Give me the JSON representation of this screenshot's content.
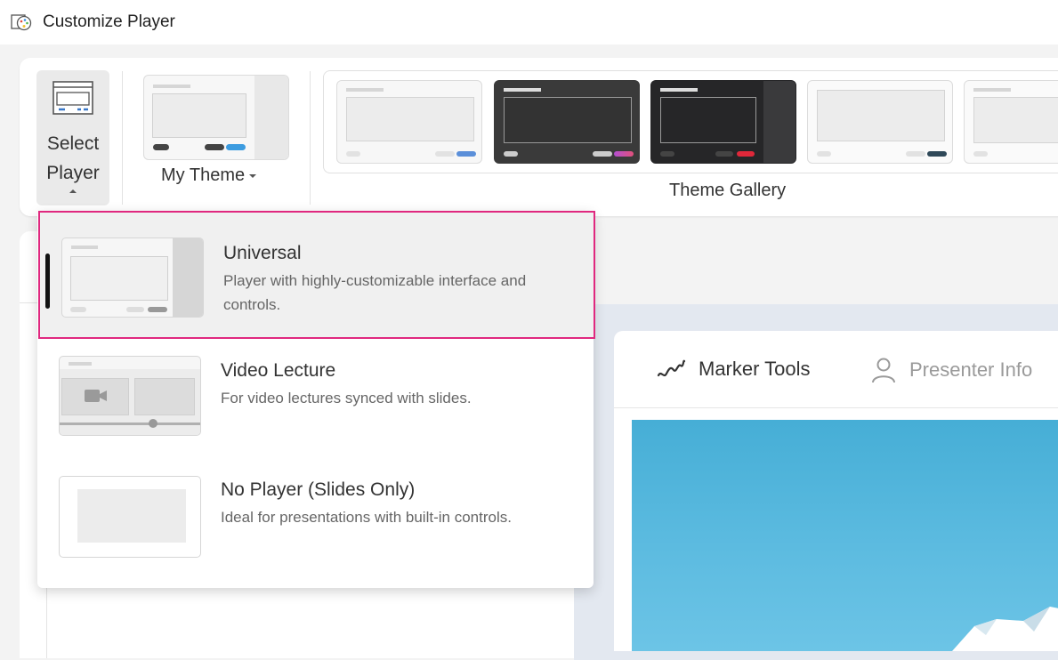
{
  "window": {
    "title": "Customize Player"
  },
  "ribbon": {
    "select_player_label": "Select Player",
    "my_theme_label": "My Theme",
    "theme_gallery_label": "Theme Gallery"
  },
  "player_menu": {
    "options": [
      {
        "title": "Universal",
        "description": "Player with highly-customizable interface and controls.",
        "selected": true
      },
      {
        "title": "Video Lecture",
        "description": "For video lectures synced with slides.",
        "selected": false
      },
      {
        "title": "No Player (Slides Only)",
        "description": "Ideal for presentations with built-in controls.",
        "selected": false
      }
    ]
  },
  "preview": {
    "tabs": [
      {
        "label": "Marker Tools",
        "icon": "marker-icon"
      },
      {
        "label": "Presenter Info",
        "icon": "person-icon"
      }
    ]
  },
  "colors": {
    "selection_outline": "#e0287f",
    "accent_blue": "#5b8fd9"
  }
}
